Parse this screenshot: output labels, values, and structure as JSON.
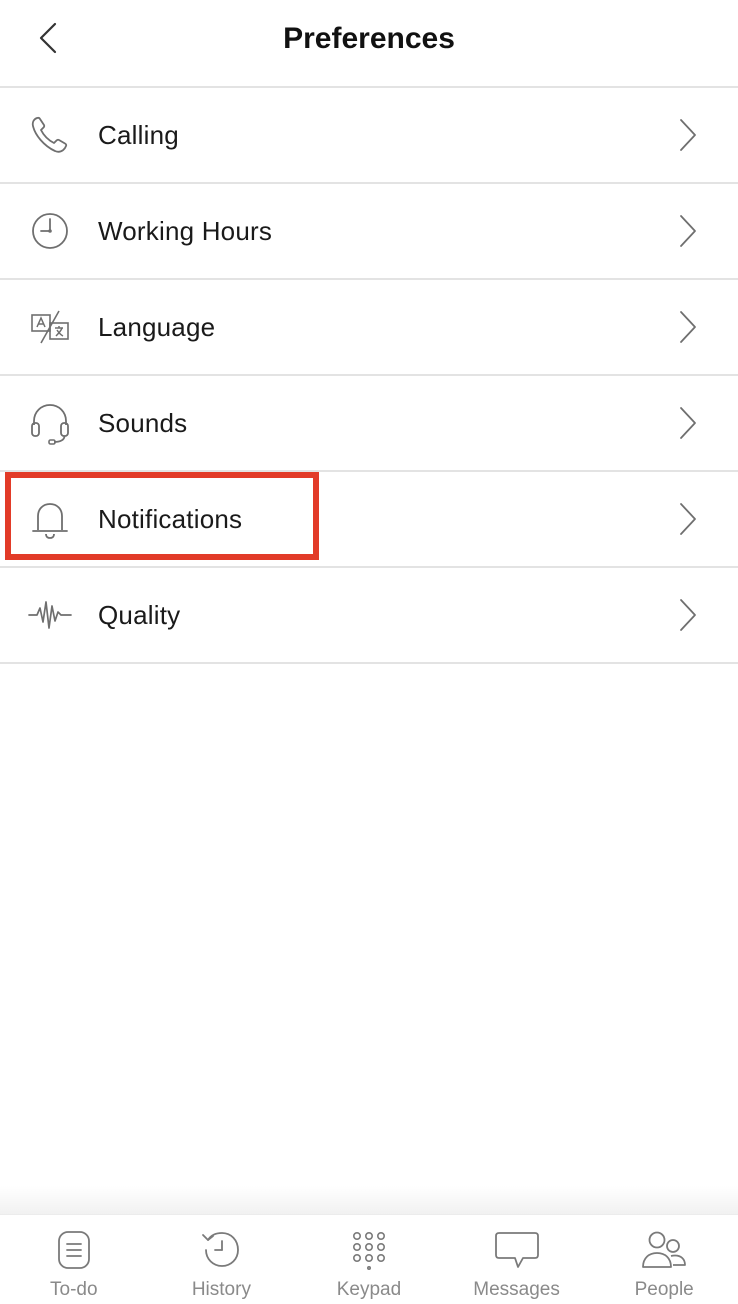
{
  "header": {
    "title": "Preferences",
    "back_icon": "chevron-left-icon"
  },
  "preferences": [
    {
      "label": "Calling",
      "icon": "phone-icon"
    },
    {
      "label": "Working Hours",
      "icon": "clock-icon"
    },
    {
      "label": "Language",
      "icon": "translate-icon"
    },
    {
      "label": "Sounds",
      "icon": "headset-icon"
    },
    {
      "label": "Notifications",
      "icon": "bell-icon"
    },
    {
      "label": "Quality",
      "icon": "waveform-icon"
    }
  ],
  "highlighted_item": "Notifications",
  "colors": {
    "highlight": "#e23b28",
    "icon": "#6f6f6f",
    "divider": "#e3e3e3",
    "tab_label": "#8a8a8a"
  },
  "tabbar": [
    {
      "label": "To-do",
      "icon": "todo-icon"
    },
    {
      "label": "History",
      "icon": "history-icon"
    },
    {
      "label": "Keypad",
      "icon": "keypad-icon"
    },
    {
      "label": "Messages",
      "icon": "messages-icon"
    },
    {
      "label": "People",
      "icon": "people-icon"
    }
  ]
}
